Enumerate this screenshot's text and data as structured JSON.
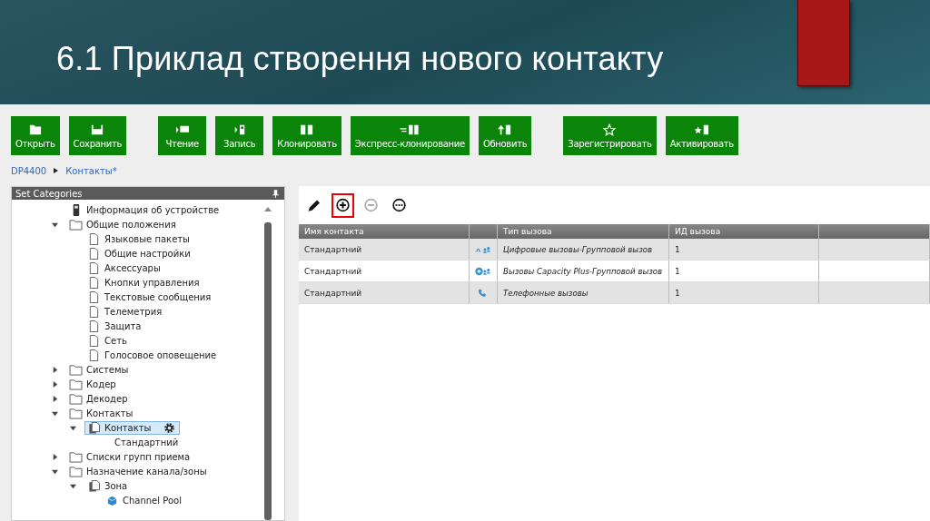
{
  "slide": {
    "title": "6.1 Приклад створення нового контакту"
  },
  "toolbar": {
    "groups": [
      [
        {
          "label": "Открыть",
          "kind": "open"
        },
        {
          "label": "Сохранить",
          "kind": "save"
        }
      ],
      [
        {
          "label": "Чтение",
          "kind": "read"
        },
        {
          "label": "Запись",
          "kind": "write"
        },
        {
          "label": "Клонировать",
          "kind": "clone"
        },
        {
          "label": "Экспресс-клонирование",
          "kind": "express"
        },
        {
          "label": "Обновить",
          "kind": "update"
        }
      ],
      [
        {
          "label": "Зарегистрировать",
          "kind": "register"
        },
        {
          "label": "Активировать",
          "kind": "activate"
        }
      ]
    ]
  },
  "breadcrumb": [
    "DP4400",
    "Контакты*"
  ],
  "sidebar": {
    "title": "Set Categories",
    "tree": [
      {
        "label": "Информация об устройстве",
        "kind": "device"
      },
      {
        "label": "Общие положения",
        "kind": "folder",
        "expanded": true,
        "children": [
          {
            "label": "Языковые пакеты",
            "kind": "page"
          },
          {
            "label": "Общие настройки",
            "kind": "page"
          },
          {
            "label": "Аксессуары",
            "kind": "page"
          },
          {
            "label": "Кнопки управления",
            "kind": "page"
          },
          {
            "label": "Текстовые сообщения",
            "kind": "page"
          },
          {
            "label": "Телеметрия",
            "kind": "page"
          },
          {
            "label": "Защита",
            "kind": "page"
          },
          {
            "label": "Сеть",
            "kind": "page"
          },
          {
            "label": "Голосовое оповещение",
            "kind": "page"
          }
        ]
      },
      {
        "label": "Системы",
        "kind": "folder",
        "expanded": false
      },
      {
        "label": "Кодер",
        "kind": "folder",
        "expanded": false
      },
      {
        "label": "Декодер",
        "kind": "folder",
        "expanded": false
      },
      {
        "label": "Контакты",
        "kind": "folder",
        "expanded": true,
        "children": [
          {
            "label": "Контакты",
            "kind": "pages",
            "expanded": true,
            "selected": true,
            "children": [
              {
                "label": "Стандартний",
                "kind": "plain",
                "selected": false
              }
            ]
          }
        ]
      },
      {
        "label": "Списки групп приема",
        "kind": "folder",
        "expanded": false
      },
      {
        "label": "Назначение канала/зоны",
        "kind": "folder",
        "expanded": true,
        "children": [
          {
            "label": "Зона",
            "kind": "pages",
            "expanded": true,
            "children": [
              {
                "label": "Channel Pool",
                "kind": "pool"
              }
            ]
          }
        ]
      }
    ]
  },
  "actions": [
    {
      "kind": "edit",
      "disabled": false,
      "highlighted": false
    },
    {
      "kind": "add",
      "disabled": false,
      "highlighted": true
    },
    {
      "kind": "remove",
      "disabled": true,
      "highlighted": false
    },
    {
      "kind": "more",
      "disabled": false,
      "highlighted": false
    }
  ],
  "table": {
    "columns": [
      "Имя контакта",
      "Тип вызова",
      "ИД вызова"
    ],
    "rows": [
      {
        "name": "Стандартний",
        "kind": "digital-group",
        "call_type": "Цифровые вызовы-Групповой вызов",
        "call_id": "1"
      },
      {
        "name": "Стандартний",
        "kind": "capacity-group",
        "call_type": "Вызовы Capacity Plus-Групповой вызов",
        "call_id": "1"
      },
      {
        "name": "Стандартний",
        "kind": "phone",
        "call_type": "Телефонные вызовы",
        "call_id": "1"
      }
    ]
  }
}
